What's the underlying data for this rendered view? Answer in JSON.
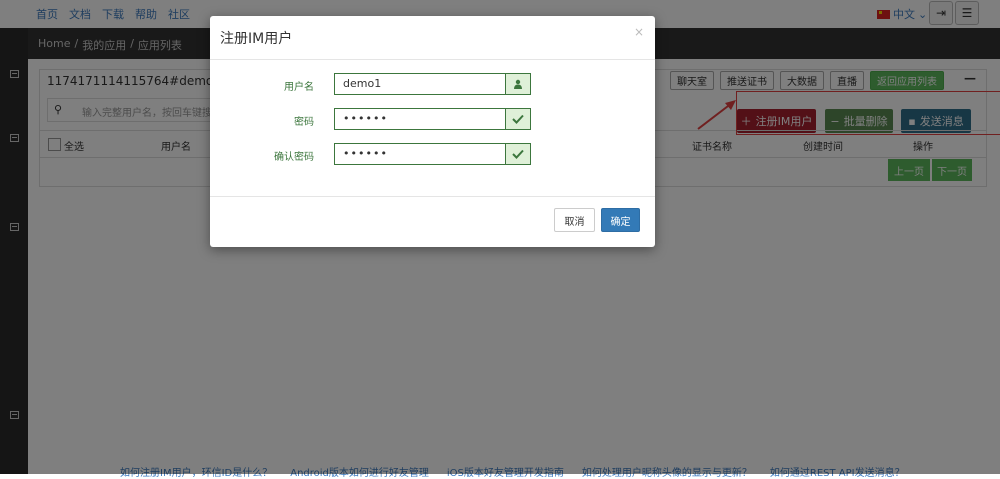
{
  "topnav": {
    "links": [
      "首页",
      "文档",
      "下载",
      "帮助",
      "社区"
    ],
    "lang": "中文"
  },
  "breadcrumb": [
    "Home",
    "/",
    "我的应用",
    "/",
    "应用列表"
  ],
  "app_panel": {
    "title": "1174171114115764#demo",
    "tabs": [
      "聊天室",
      "推送证书",
      "大数据",
      "直播"
    ],
    "back_label": "返回应用列表",
    "search_placeholder": "输入完整用户名，按回车键搜",
    "table_headers": [
      "全选",
      "用户名",
      "证书名称",
      "创建时间",
      "操作"
    ],
    "actions": {
      "register": "注册IM用户",
      "batch_delete": "批量删除",
      "send_message": "发送消息"
    },
    "pager": {
      "prev": "上一页",
      "next": "下一页"
    }
  },
  "footer_links": [
    "如何注册IM用户，环信ID是什么？",
    "Android版本如何进行好友管理",
    "iOS版本好友管理开发指南",
    "如何处理用户昵称头像的显示与更新？",
    "如何通过REST API发送消息？"
  ],
  "modal": {
    "title": "注册IM用户",
    "close_label": "×",
    "fields": [
      {
        "label": "用户名",
        "value": "demo1",
        "icon": "user-icon"
      },
      {
        "label": "密码",
        "value": "••••••",
        "icon": "check-icon"
      },
      {
        "label": "确认密码",
        "value": "••••••",
        "icon": "check-icon"
      }
    ],
    "cancel_label": "取消",
    "ok_label": "确定"
  },
  "colors": {
    "success": "#3c763d",
    "success_bg": "#dff0d8",
    "primary": "#337ab7",
    "danger": "#a7212f",
    "info": "#2f6e8a",
    "highlight": "#e04040"
  }
}
